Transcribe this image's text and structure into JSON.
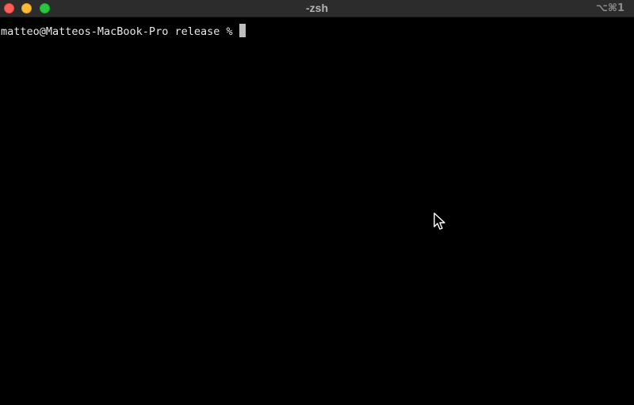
{
  "window": {
    "title": "-zsh",
    "shortcut": "⌥⌘1",
    "traffic_lights": {
      "close_color": "#ff5f57",
      "minimize_color": "#febc2e",
      "zoom_color": "#28c840"
    }
  },
  "terminal": {
    "background": "#000000",
    "foreground": "#e8e8e8",
    "prompt": "matteo@Matteos-MacBook-Pro release %",
    "input": ""
  },
  "icons": {
    "cursor": "arrow-pointer-icon"
  }
}
